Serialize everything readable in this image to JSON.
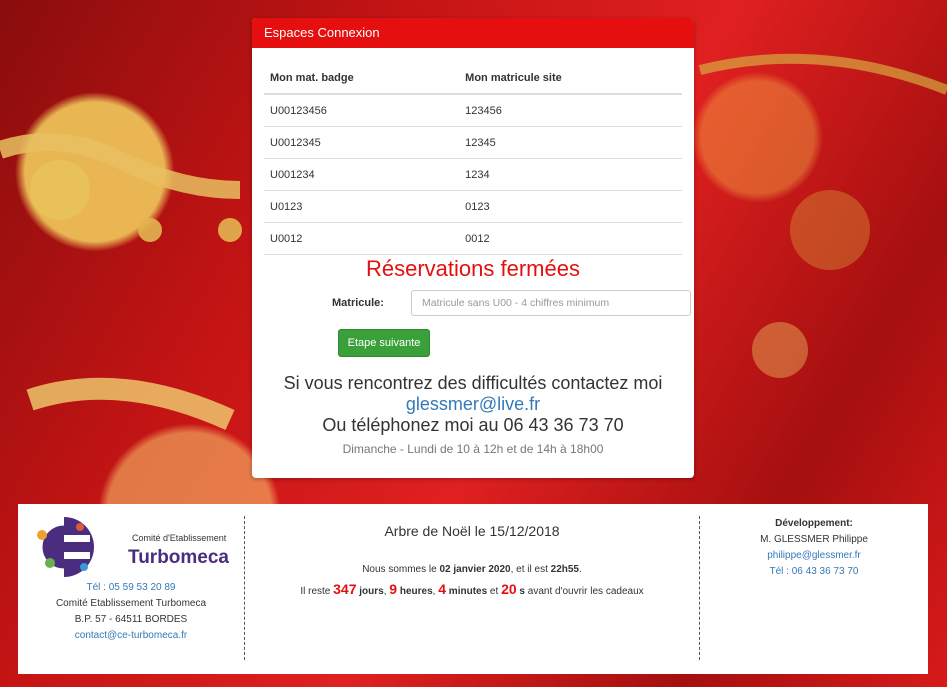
{
  "panel": {
    "heading": "Espaces Connexion",
    "table": {
      "headers": [
        "Mon mat. badge",
        "Mon matricule site"
      ],
      "rows": [
        [
          "U00123456",
          "123456"
        ],
        [
          "U0012345",
          "12345"
        ],
        [
          "U001234",
          "1234"
        ],
        [
          "U0123",
          "0123"
        ],
        [
          "U0012",
          "0012"
        ]
      ]
    },
    "closed_title": "Réservations fermées",
    "matricule_label": "Matricule:",
    "matricule_placeholder": "Matricule sans U00 - 4 chiffres minimum",
    "next_button": "Etape suivante",
    "help_line": "Si vous rencontrez des difficultés contactez moi",
    "help_email": "glessmer@live.fr",
    "help_phone": "Ou téléphonez moi au 06 43 36 73 70",
    "help_hours": "Dimanche - Lundi de 10 à 12h et de 14h à 18h00"
  },
  "footer": {
    "logo": {
      "small_text": "Comité d'Etablissement",
      "brand": "Turbomeca",
      "letters": "CE"
    },
    "left": {
      "tel": "Tél : 05 59 53 20 89",
      "org": "Comité Etablissement Turbomeca",
      "address": "B.P. 57 - 64511 BORDES",
      "email": "contact@ce-turbomeca.fr"
    },
    "center": {
      "title": "Arbre de Noël le 15/12/2018",
      "l1_a": "Nous sommes le ",
      "l1_date": "02 janvier 2020",
      "l1_b": ", et il est ",
      "l1_time": "22h55",
      "l1_c": ".",
      "l2_a": "Il reste ",
      "days": "347",
      "days_label": " jours",
      "hours": "9",
      "hours_label": " heures",
      "minutes": "4",
      "minutes_label": " minutes",
      "and": " et ",
      "seconds": "20",
      "seconds_label": " s",
      "l2_end": " avant d'ouvrir les cadeaux"
    },
    "right": {
      "title": "Développement:",
      "name": "M. GLESSMER Philippe",
      "email": "philippe@glessmer.fr",
      "tel": "Tél : 06 43 36 73 70"
    }
  },
  "colors": {
    "accent_red": "#e50f0f",
    "button_green": "#3aa03a",
    "link_blue": "#337ab7"
  }
}
